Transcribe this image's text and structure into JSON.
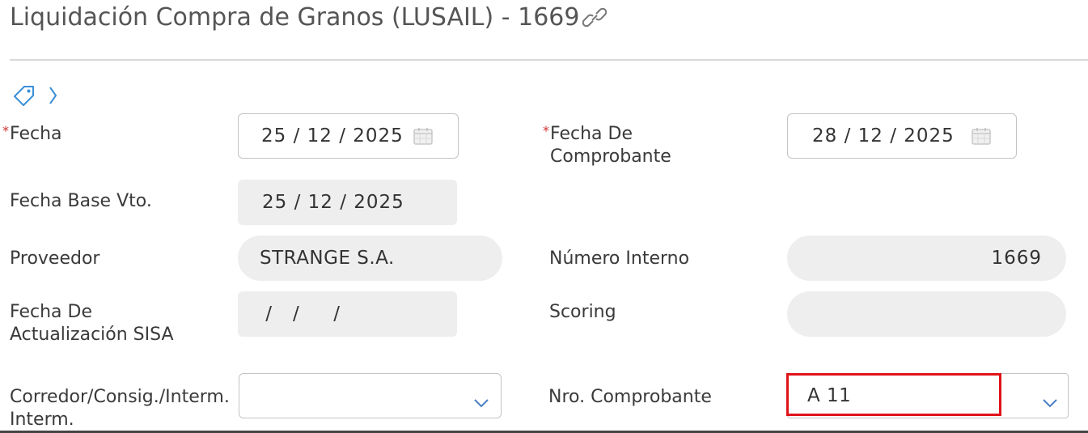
{
  "header": {
    "title": "Liquidación Compra de Granos (LUSAIL) - 1669",
    "link_icon": "link-icon"
  },
  "toolbar": {
    "tag_icon": "tag-icon",
    "expand_icon": "chevron-right-icon"
  },
  "form": {
    "fecha": {
      "label": "Fecha",
      "value": "25 / 12 / 2025",
      "required": true
    },
    "fecha_comprobante": {
      "label_line1": "Fecha De",
      "label_line2": "Comprobante",
      "value": "28 / 12 / 2025",
      "required": true
    },
    "fecha_base_vto": {
      "label": "Fecha Base Vto.",
      "value": "25 / 12 / 2025"
    },
    "proveedor": {
      "label": "Proveedor",
      "value": "STRANGE S.A."
    },
    "numero_interno": {
      "label": "Número Interno",
      "value": "1669"
    },
    "fecha_sisa": {
      "label_line1": "Fecha De",
      "label_line2": "Actualización SISA",
      "value": " /   /     /"
    },
    "scoring": {
      "label": "Scoring",
      "value": ""
    },
    "corredor": {
      "label_line1": "Corredor/Consig./Interm.",
      "label_line2": "Interm.",
      "value": ""
    },
    "nro_comprobante": {
      "label": "Nro. Comprobante",
      "value": "A 11"
    }
  },
  "colors": {
    "required_marker": "#d32f2f",
    "highlight_border": "#e0131a",
    "readonly_bg": "#eeeeee",
    "icon_blue": "#3a8fd6"
  }
}
